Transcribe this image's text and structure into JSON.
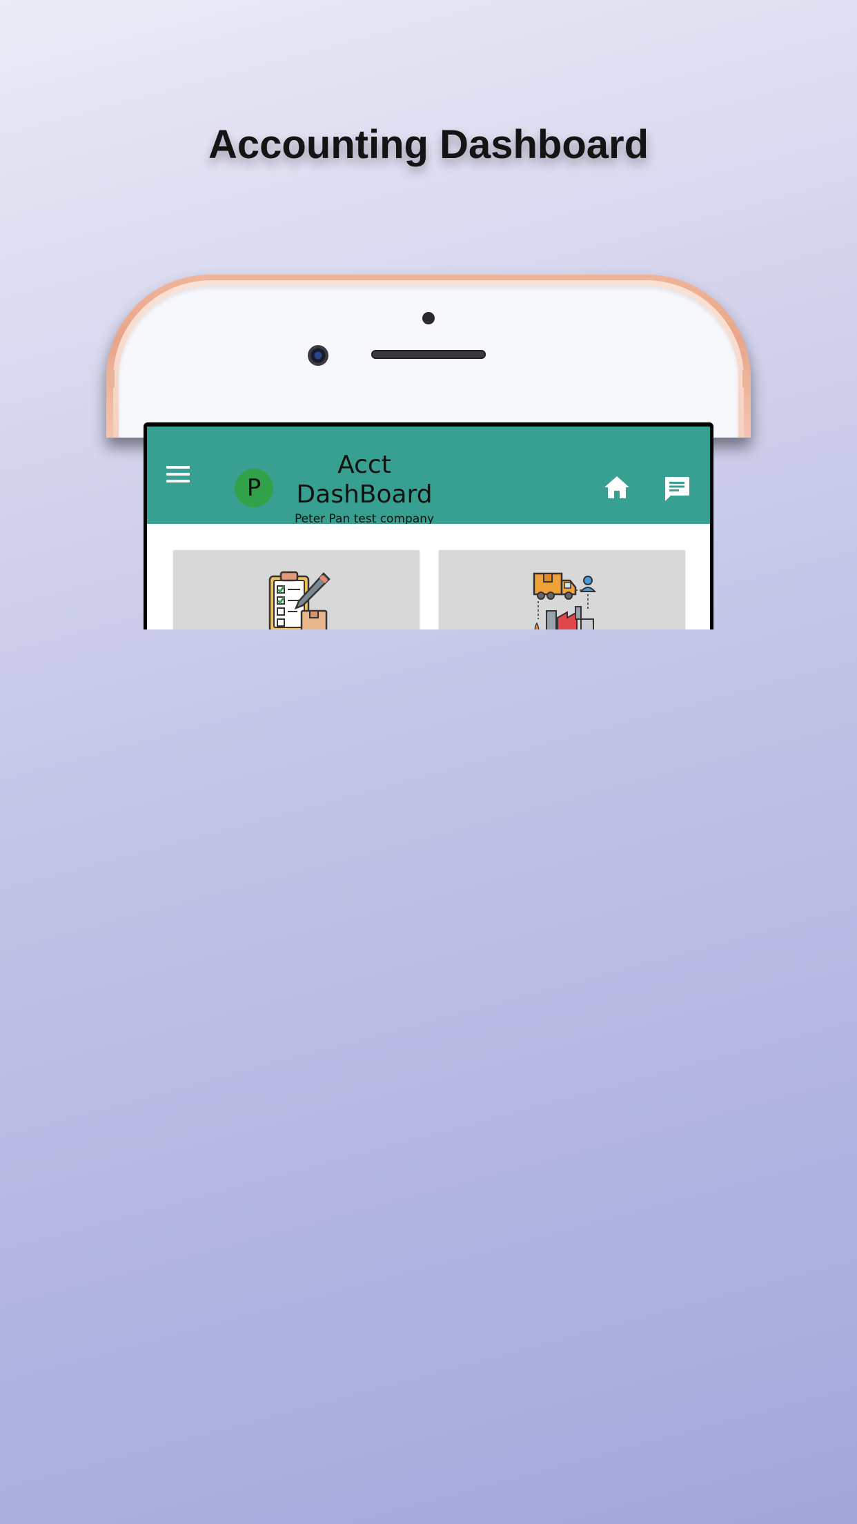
{
  "page_title": "Accounting Dashboard",
  "app_bar": {
    "avatar_letter": "P",
    "title": "Acct DashBoard",
    "subtitle": "Peter Pan test company",
    "color": "#37a090"
  },
  "icons": {
    "menu": "hamburger-menu-icon",
    "home": "home-icon",
    "chat": "chat-message-icon",
    "tile_1": "clipboard-checklist-icon",
    "tile_2": "delivery-truck-factory-icon"
  }
}
